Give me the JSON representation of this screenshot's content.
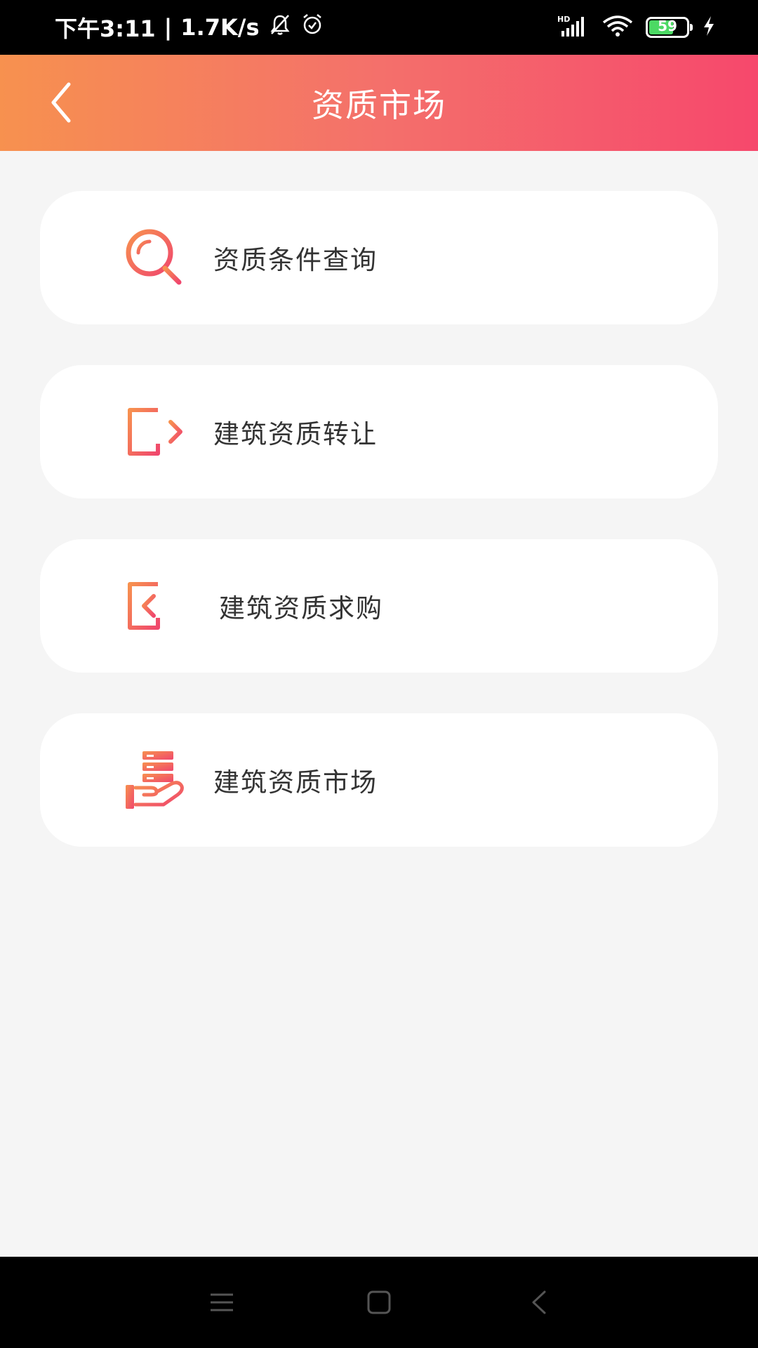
{
  "status_bar": {
    "time": "下午3:11",
    "separator": "|",
    "net_speed": "1.7K/s",
    "battery_level": "59",
    "icons": [
      "mute-bell-icon",
      "alarm-icon",
      "hd-signal-icon",
      "wifi-icon",
      "battery-icon",
      "charging-icon"
    ]
  },
  "header": {
    "title": "资质市场",
    "back_icon": "chevron-left-icon",
    "gradient": [
      "#f7914f",
      "#f4706b",
      "#f6486c"
    ]
  },
  "menu": {
    "items": [
      {
        "label": "资质条件查询",
        "icon": "search-icon"
      },
      {
        "label": "建筑资质转让",
        "icon": "export-icon"
      },
      {
        "label": "建筑资质求购",
        "icon": "import-icon"
      },
      {
        "label": "建筑资质市场",
        "icon": "hand-stack-icon"
      }
    ]
  },
  "nav_bar": {
    "icons": [
      "menu-icon",
      "home-icon",
      "back-icon"
    ]
  },
  "colors": {
    "background": "#f5f5f5",
    "card": "#ffffff",
    "text": "#333333",
    "icon_gradient_start": "#f7914f",
    "icon_gradient_end": "#f0476d"
  }
}
